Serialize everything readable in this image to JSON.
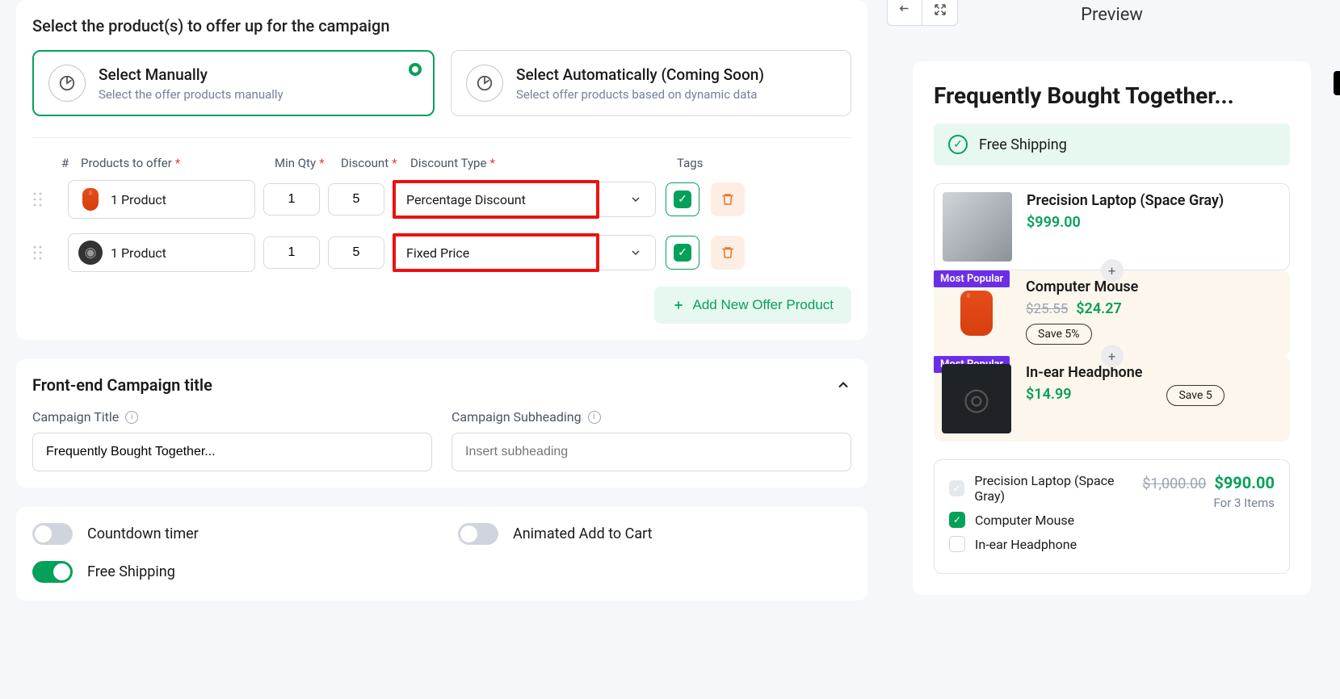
{
  "section_head": "Select the product(s) to offer up for the campaign",
  "select_manual": {
    "title": "Select Manually",
    "sub": "Select the offer products manually"
  },
  "select_auto": {
    "title": "Select Automatically (Coming Soon)",
    "sub": "Select offer products based on dynamic data"
  },
  "table": {
    "hash": "#",
    "products": "Products to offer",
    "minqty": "Min Qty",
    "discount": "Discount",
    "type": "Discount Type",
    "tags": "Tags"
  },
  "rows": [
    {
      "product_label": "1 Product",
      "minqty": "1",
      "discount": "5",
      "type": "Percentage Discount"
    },
    {
      "product_label": "1 Product",
      "minqty": "1",
      "discount": "5",
      "type": "Fixed Price"
    }
  ],
  "add_btn": "Add New Offer Product",
  "frontend": {
    "title": "Front-end Campaign title",
    "campaign_title_label": "Campaign Title",
    "campaign_title_value": "Frequently Bought Together...",
    "subheading_label": "Campaign Subheading",
    "subheading_placeholder": "Insert subheading"
  },
  "toggles": {
    "countdown": "Countdown timer",
    "animated": "Animated Add to Cart",
    "freeship": "Free Shipping"
  },
  "preview": {
    "label": "Preview",
    "heading": "Frequently Bought Together...",
    "freeship": "Free Shipping",
    "products": [
      {
        "name": "Precision Laptop (Space Gray)",
        "price": "$999.00"
      },
      {
        "name": "Computer Mouse",
        "old": "$25.55",
        "price": "$24.27",
        "save": "Save 5%",
        "popular": "Most Popular"
      },
      {
        "name": "In-ear Headphone",
        "price": "$14.99",
        "save": "Save 5",
        "popular": "Most Popular"
      }
    ],
    "summary": {
      "items": [
        "Precision Laptop (Space Gray)",
        "Computer Mouse",
        "In-ear Headphone"
      ],
      "old_total": "$1,000.00",
      "new_total": "$990.00",
      "for_items": "For 3 Items"
    }
  }
}
